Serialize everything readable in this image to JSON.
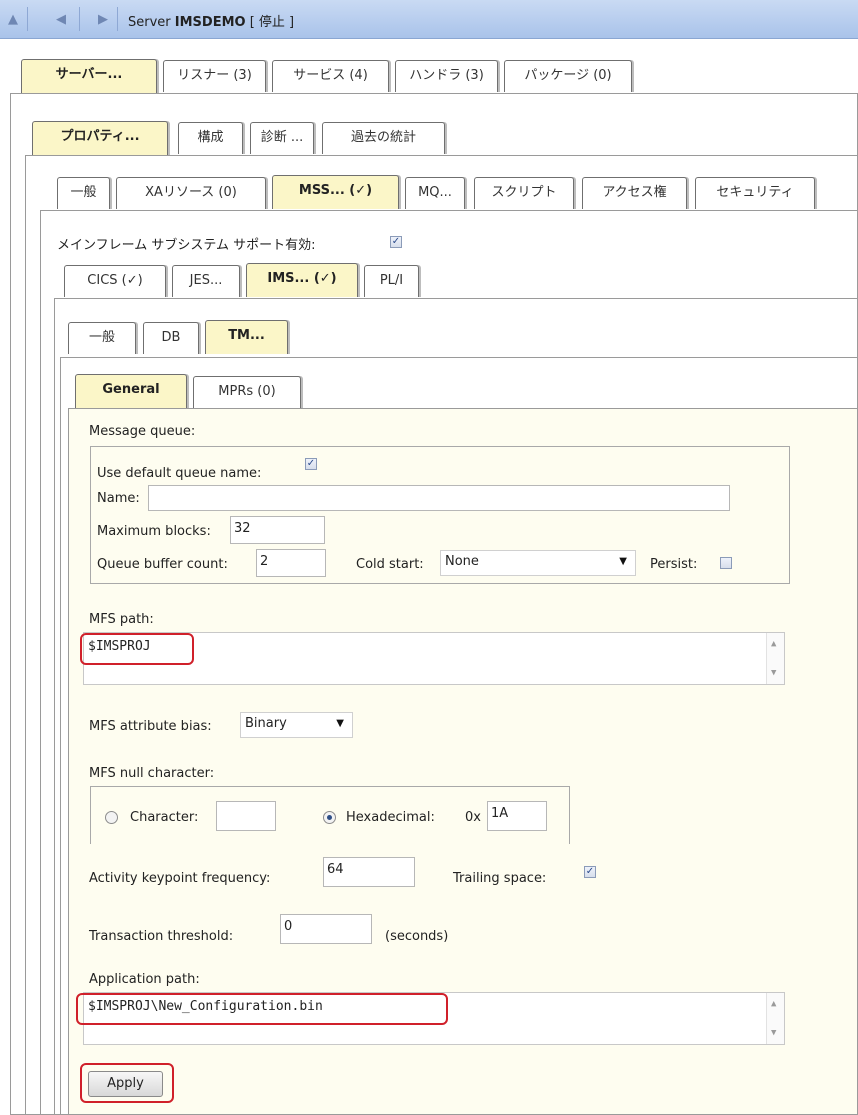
{
  "titlebar": {
    "nav_up": "▲",
    "nav_back": "◀",
    "nav_forward": "▶",
    "prefix": "Server ",
    "server_name": "IMSDEMO",
    "status": " [ 停止 ]"
  },
  "tabs_level1": [
    "サーバー...",
    "リスナー (3)",
    "サービス (4)",
    "ハンドラ (3)",
    "パッケージ (0)"
  ],
  "tabs_level2": [
    "プロパティ...",
    "構成",
    "診断 ...",
    "過去の統計"
  ],
  "tabs_level3": [
    "一般",
    "XAリソース (0)",
    "MSS... (✓)",
    "MQ...",
    "スクリプト",
    "アクセス権",
    "セキュリティ"
  ],
  "mainframe_support_label": "メインフレーム サブシステム サポート有効:",
  "tabs_level4": [
    "CICS (✓)",
    "JES...",
    "IMS... (✓)",
    "PL/I"
  ],
  "tabs_level5": [
    "一般",
    "DB",
    "TM..."
  ],
  "tabs_level6": [
    "General",
    "MPRs (0)"
  ],
  "message_queue": {
    "group_label": "Message queue:",
    "use_default_label": "Use default queue name:",
    "use_default_checked": true,
    "name_label": "Name:",
    "name_value": "",
    "max_blocks_label": "Maximum blocks:",
    "max_blocks_value": "32",
    "buffer_count_label": "Queue buffer count:",
    "buffer_count_value": "2",
    "cold_start_label": "Cold start:",
    "cold_start_value": "None",
    "persist_label": "Persist:",
    "persist_checked": false
  },
  "mfs_path": {
    "label": "MFS path:",
    "value": "$IMSPROJ"
  },
  "mfs_attribute_bias": {
    "label": "MFS attribute bias:",
    "value": "Binary"
  },
  "mfs_null_character": {
    "label": "MFS null character:",
    "character_label": "Character:",
    "character_value": "",
    "hex_label": "Hexadecimal:",
    "hex_prefix": "0x",
    "hex_value": "1A",
    "selected": "Hexadecimal"
  },
  "activity_keypoint": {
    "label": "Activity keypoint frequency:",
    "value": "64"
  },
  "trailing_space": {
    "label": "Trailing space:",
    "checked": true
  },
  "transaction_threshold": {
    "label": "Transaction threshold:",
    "value": "0",
    "unit": "(seconds)"
  },
  "application_path": {
    "label": "Application path:",
    "value": "$IMSPROJ\\New_Configuration.bin"
  },
  "apply_button": "Apply",
  "colors": {
    "highlight": "#d0202a",
    "active_tab": "#fbf6c8",
    "panel_cream": "#fefdf0",
    "titlebar": "#b4cbee"
  },
  "icons": {
    "checked": "check-icon",
    "dropdown": "dropdown-arrow-icon",
    "scroll_up": "scroll-up-arrow-icon",
    "scroll_down": "scroll-down-arrow-icon"
  }
}
